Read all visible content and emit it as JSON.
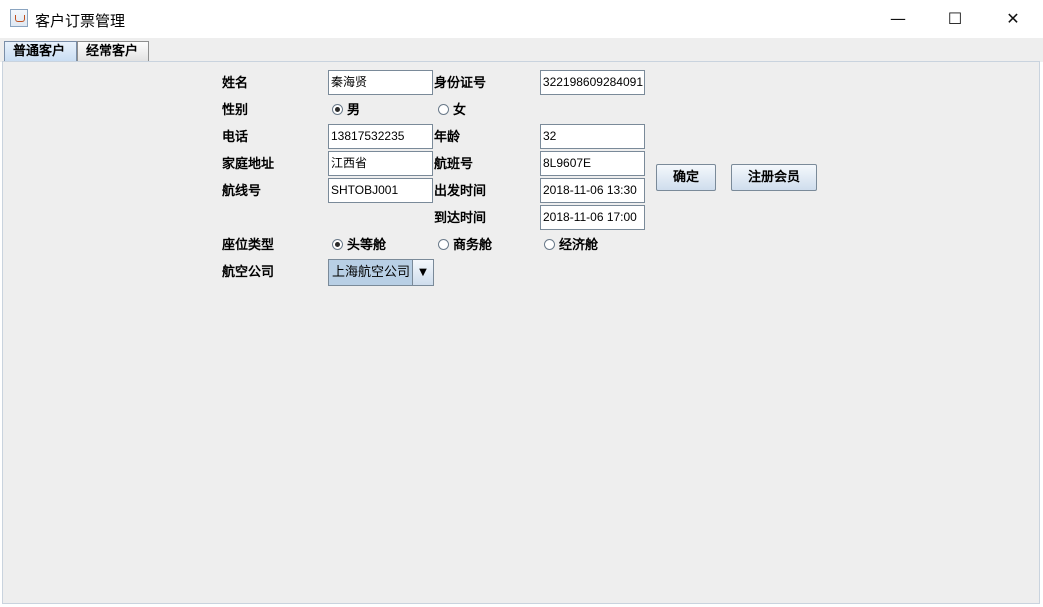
{
  "window": {
    "title": "客户订票管理",
    "minimize_glyph": "—",
    "maximize_glyph": "☐",
    "close_glyph": "✕"
  },
  "tabs": [
    {
      "label": "普通客户",
      "active": true
    },
    {
      "label": "经常客户",
      "active": false
    }
  ],
  "form": {
    "name_label": "姓名",
    "name_value": "秦海贤",
    "id_label": "身份证号",
    "id_value": "322198609284091",
    "gender_label": "性别",
    "gender_options": [
      {
        "label": "男",
        "selected": true
      },
      {
        "label": "女",
        "selected": false
      }
    ],
    "phone_label": "电话",
    "phone_value": "13817532235",
    "age_label": "年龄",
    "age_value": "32",
    "address_label": "家庭地址",
    "address_value": "江西省",
    "flight_no_label": "航班号",
    "flight_no_value": "8L9607E",
    "route_label": "航线号",
    "route_value": "SHTOBJ001",
    "depart_label": "出发时间",
    "depart_value": "2018-11-06 13:30",
    "arrive_label": "到达时间",
    "arrive_value": "2018-11-06 17:00",
    "seat_label": "座位类型",
    "seat_options": [
      {
        "label": "头等舱",
        "selected": true
      },
      {
        "label": "商务舱",
        "selected": false
      },
      {
        "label": "经济舱",
        "selected": false
      }
    ],
    "airline_label": "航空公司",
    "airline_value": "上海航空公司",
    "airline_arrow": "▼"
  },
  "buttons": {
    "confirm": "确定",
    "register": "注册会员"
  }
}
